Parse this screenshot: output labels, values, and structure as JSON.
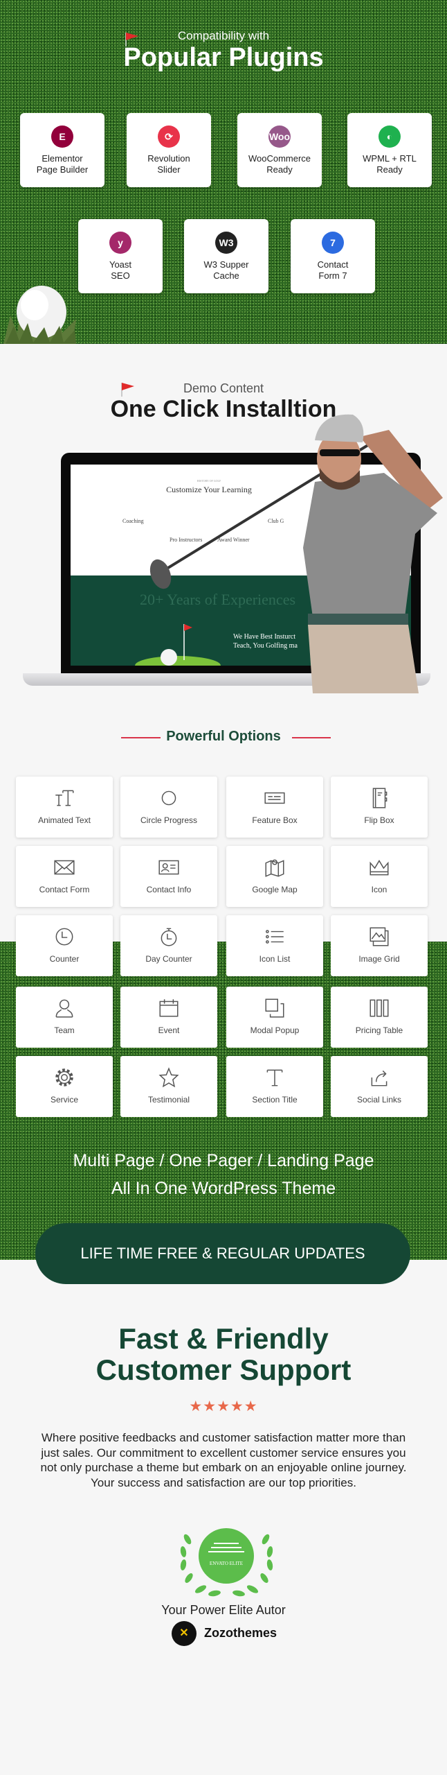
{
  "plugins": {
    "subtitle": "Compatibility with",
    "title": "Popular Plugins",
    "items": [
      {
        "line1": "Elementor",
        "line2": "Page Builder",
        "icon": "elementor-icon",
        "glyph": "E",
        "color": "#92003b"
      },
      {
        "line1": "Revolution",
        "line2": "Slider",
        "icon": "revolution-slider-icon",
        "glyph": "⟳",
        "color": "#e8334a"
      },
      {
        "line1": "WooCommerce",
        "line2": "Ready",
        "icon": "woocommerce-icon",
        "glyph": "Woo",
        "color": "#96588a"
      },
      {
        "line1": "WPML + RTL",
        "line2": "Ready",
        "icon": "wpml-icon",
        "glyph": "◐",
        "color": "#1fb14f"
      },
      {
        "line1": "Yoast",
        "line2": "SEO",
        "icon": "yoast-icon",
        "glyph": "y",
        "color": "#a4286a"
      },
      {
        "line1": "W3 Supper",
        "line2": "Cache",
        "icon": "w3-cache-icon",
        "glyph": "W3",
        "color": "#222222"
      },
      {
        "line1": "Contact",
        "line2": "Form 7",
        "icon": "contact-form-7-icon",
        "glyph": "7",
        "color": "#2c6be0"
      }
    ]
  },
  "demo": {
    "subtitle": "Demo Content",
    "title": "One Click Installtion",
    "screen": {
      "kicker": "HISTORY OF GOLF",
      "heading": "Customize Your Learning",
      "features": [
        "Coaching",
        "Pro Instructors",
        "Award Winner",
        "Club G"
      ],
      "banner": "20+ Years of Experiences",
      "about_line1": "We Have Best Insturct",
      "about_line2": "Teach, You Golfing ma"
    }
  },
  "options": {
    "title": "Powerful Options",
    "items": [
      {
        "label": "Animated Text",
        "icon": "text-size"
      },
      {
        "label": "Circle Progress",
        "icon": "circle"
      },
      {
        "label": "Feature Box",
        "icon": "feature-box"
      },
      {
        "label": "Flip Box",
        "icon": "flip-box"
      },
      {
        "label": "Contact Form",
        "icon": "envelope"
      },
      {
        "label": "Contact Info",
        "icon": "contact-card"
      },
      {
        "label": "Google Map",
        "icon": "map"
      },
      {
        "label": "Icon",
        "icon": "crown"
      },
      {
        "label": "Counter",
        "icon": "clock"
      },
      {
        "label": "Day Counter",
        "icon": "stopwatch"
      },
      {
        "label": "Icon List",
        "icon": "list"
      },
      {
        "label": "Image Grid",
        "icon": "image-grid"
      },
      {
        "label": "Team",
        "icon": "user"
      },
      {
        "label": "Event",
        "icon": "calendar"
      },
      {
        "label": "Modal Popup",
        "icon": "modal"
      },
      {
        "label": "Pricing Table",
        "icon": "columns"
      },
      {
        "label": "Service",
        "icon": "gear"
      },
      {
        "label": "Testimonial",
        "icon": "star"
      },
      {
        "label": "Section Title",
        "icon": "title-t"
      },
      {
        "label": "Social Links",
        "icon": "share"
      }
    ]
  },
  "theme": {
    "line1": "Multi Page / One Pager / Landing Page",
    "line2": "All In One WordPress Theme",
    "button": "LIFE TIME FREE & REGULAR UPDATES"
  },
  "support": {
    "title1": "Fast & Friendly",
    "title2": "Customer Support",
    "rating": 5,
    "text": "Where positive feedbacks and customer satisfaction matter more than just sales. Our commitment to excellent customer service ensures you not only purchase a theme but embark on an enjoyable online journey. Your success and satisfaction are our top priorities.",
    "badge": "ENVATO ELITE",
    "author_label": "Your Power Elite Autor",
    "brand": "Zozothemes"
  },
  "colors": {
    "accent_red": "#d9344a",
    "dark_green": "#154734",
    "star": "#e8684a",
    "badge_green": "#5cbd4b"
  }
}
